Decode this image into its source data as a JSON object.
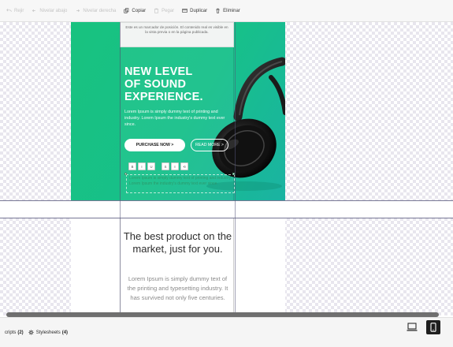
{
  "toolbar": {
    "items": [
      {
        "label": "Rejir",
        "icon": "undo-icon",
        "enabled": false
      },
      {
        "label": "Nivelar abajo",
        "icon": "arrow-left-icon",
        "enabled": false
      },
      {
        "label": "Nivelar derecha",
        "icon": "arrow-right-icon",
        "enabled": false
      },
      {
        "label": "Copiar",
        "icon": "copy-icon",
        "enabled": true
      },
      {
        "label": "Pegar",
        "icon": "paste-icon",
        "enabled": false
      },
      {
        "label": "Duplicar",
        "icon": "duplicate-icon",
        "enabled": true
      },
      {
        "label": "Eliminar",
        "icon": "trash-icon",
        "enabled": true
      }
    ]
  },
  "email": {
    "placeholder_note": "Este es un marcador de posición. El contenido real es visible en la vista previa o en la página publicada.",
    "hero_title_lines": [
      "NEW LEVEL",
      "OF SOUND",
      "EXPERIENCE."
    ],
    "hero_body": "Lorem Ipsum is simply dummy text of printing and industry. Lorem Ipsum the industry's dummy text ever since.",
    "purchase_label": "PURCHASE NOW >",
    "read_more_label": "READ MORE >",
    "rte_buttons": [
      "B",
      "I",
      "U",
      "S",
      "≡",
      "⟲",
      "↯"
    ],
    "selected_text": "Lorem Ipsum is simply dummy text of printing and industry. Lorem Ipsum the industry's dummy text ever since.",
    "section_title": "The best product on the market, just for you.",
    "section_body": "Lorem Ipsum is simply dummy text of the printing and typesetting industry. It has survived not only five centuries."
  },
  "bottombar": {
    "scripts_label": "cripts",
    "scripts_count": "(2)",
    "stylesheets_label": "Stylesheets",
    "stylesheets_count": "(4)"
  },
  "colors": {
    "hero_green": "#18c27f",
    "hero_teal": "#1ab3a2",
    "guide_line": "#55557a"
  }
}
